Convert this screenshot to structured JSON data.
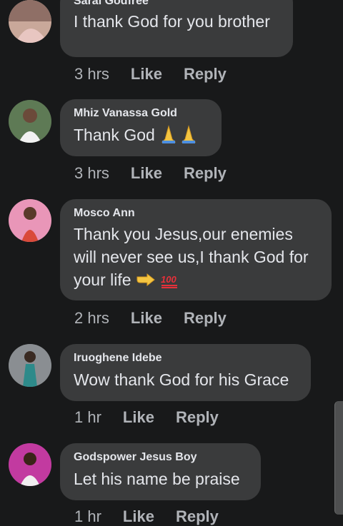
{
  "comments": [
    {
      "author": "Sarai Godfree",
      "text": "I thank God for you brother",
      "time": "3 hrs",
      "like": "Like",
      "reply": "Reply"
    },
    {
      "author": "Mhiz Vanassa Gold",
      "text": "Thank God",
      "emoji": "folded-hands-icon x2",
      "time": "3 hrs",
      "like": "Like",
      "reply": "Reply"
    },
    {
      "author": "Mosco Ann",
      "text_line1": "Thank you Jesus,our enemies",
      "text_line2": "will never see us,I thank God for",
      "text_line3": "your life",
      "emoji": "pointing-hand-icon, hundred-points-icon",
      "time": "2 hrs",
      "like": "Like",
      "reply": "Reply"
    },
    {
      "author": "Iruoghene Idebe",
      "text": "Wow thank God for his Grace",
      "time": "1 hr",
      "like": "Like",
      "reply": "Reply"
    },
    {
      "author": "Godspower Jesus Boy",
      "text": "Let his name be praise",
      "time": "1 hr",
      "like": "Like",
      "reply": "Reply"
    }
  ],
  "colors": {
    "background": "#18191a",
    "bubble": "#3a3b3c",
    "text": "#e4e6eb",
    "meta": "#b0b3b8"
  }
}
